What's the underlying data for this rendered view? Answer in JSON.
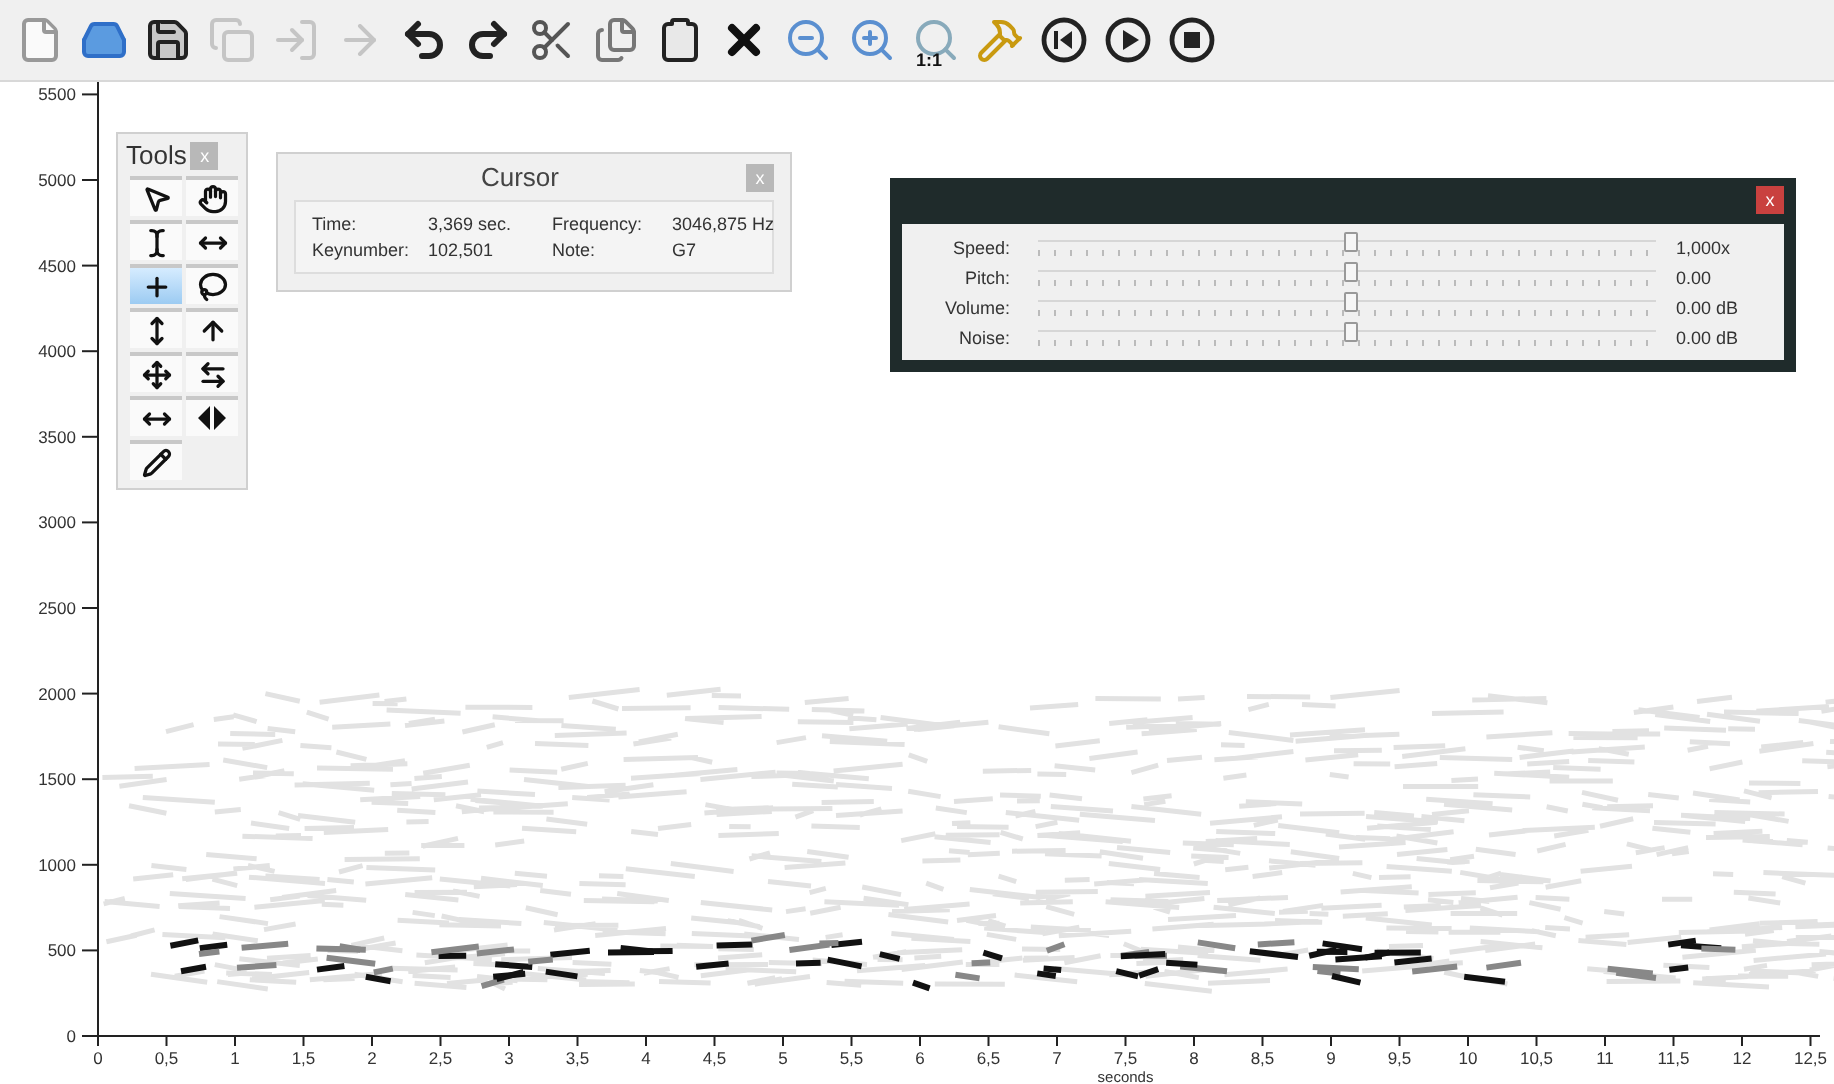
{
  "toolbar": [
    {
      "disabled": false
    },
    {
      "disabled": false
    },
    {
      "disabled": false
    },
    {
      "disabled": true
    },
    {
      "disabled": true
    },
    {
      "disabled": true
    },
    {
      "disabled": false
    },
    {
      "disabled": false
    },
    {
      "disabled": false
    },
    {
      "disabled": false
    },
    {
      "disabled": false
    },
    {
      "disabled": false
    },
    {
      "disabled": false
    },
    {
      "disabled": false
    },
    {
      "disabled": false,
      "label": "1:1"
    },
    {
      "disabled": false
    },
    {
      "disabled": false
    },
    {
      "disabled": false
    },
    {
      "disabled": false
    }
  ],
  "spectrogram": {
    "y_axis_labels": [
      "5500",
      "5000",
      "4500",
      "4000",
      "3500",
      "3000",
      "2500",
      "2000",
      "1500",
      "1000",
      "500",
      "0"
    ],
    "x_axis_labels": [
      "0",
      "0,5",
      "1",
      "1,5",
      "2",
      "2,5",
      "3",
      "3,5",
      "4",
      "4,5",
      "5",
      "5,5",
      "6",
      "6,5",
      "7",
      "7,5",
      "8",
      "8,5",
      "9",
      "9,5",
      "10",
      "10,5",
      "11",
      "11,5",
      "12",
      "12,5"
    ],
    "x_title": "seconds"
  },
  "tools_panel": {
    "title": "Tools",
    "close": "x",
    "tools": [
      {
        "selected": false
      },
      {
        "selected": false
      },
      {
        "selected": false
      },
      {
        "selected": false
      },
      {
        "selected": true
      },
      {
        "selected": false
      },
      {
        "selected": false
      },
      {
        "selected": false
      },
      {
        "selected": false
      },
      {
        "selected": false
      },
      {
        "selected": false
      },
      {
        "selected": false
      },
      {
        "selected": false
      }
    ]
  },
  "cursor_panel": {
    "title": "Cursor",
    "close": "x",
    "fields": [
      {
        "label": "Time:",
        "value": "3,369 sec."
      },
      {
        "label": "Frequency:",
        "value": "3046,875 Hz"
      },
      {
        "label": "Keynumber:",
        "value": "102,501"
      },
      {
        "label": "Note:",
        "value": "G7"
      }
    ]
  },
  "playback_panel": {
    "close": "x",
    "sliders": [
      {
        "label": "Speed:",
        "level": 0.5,
        "reading": "1,000x"
      },
      {
        "label": "Pitch:",
        "level": 0.5,
        "reading": "0.00"
      },
      {
        "label": "Volume:",
        "level": 0.5,
        "reading": "0.00 dB"
      },
      {
        "label": "Noise:",
        "level": 0.5,
        "reading": "0.00 dB"
      }
    ]
  }
}
